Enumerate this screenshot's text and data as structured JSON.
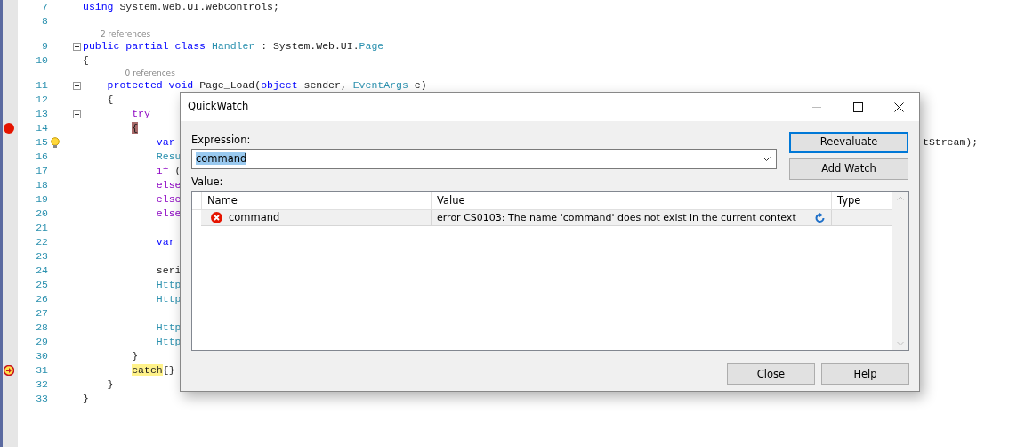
{
  "editor": {
    "lines": [
      {
        "number": "7",
        "tokens": [
          {
            "text": "using",
            "kind": "keyword"
          },
          {
            "text": " System.Web.UI.WebControls;",
            "kind": "plain"
          }
        ]
      },
      {
        "number": "8"
      },
      {
        "number": "9",
        "lens": "2 references",
        "fold": true,
        "tokens": [
          {
            "text": "public partial class",
            "kind": "keyword"
          },
          {
            "text": " Handler",
            "kind": "type"
          },
          {
            "text": " : System.Web.UI.",
            "kind": "plain"
          },
          {
            "text": "Page",
            "kind": "type"
          }
        ]
      },
      {
        "number": "10",
        "tokens": [
          {
            "text": "{",
            "kind": "plain"
          }
        ]
      },
      {
        "number": "11",
        "lens": "0 references",
        "fold": true,
        "tokens": [
          {
            "text": "    protected void",
            "kind": "keyword"
          },
          {
            "text": " Page_Load(",
            "kind": "plain"
          },
          {
            "text": "object",
            "kind": "keyword"
          },
          {
            "text": " sender, ",
            "kind": "plain"
          },
          {
            "text": "EventArgs",
            "kind": "type"
          },
          {
            "text": " e)",
            "kind": "plain"
          }
        ]
      },
      {
        "number": "12",
        "tokens": [
          {
            "text": "    {",
            "kind": "plain"
          }
        ]
      },
      {
        "number": "13",
        "fold": true,
        "tokens": [
          {
            "text": "        try",
            "kind": "control"
          }
        ]
      },
      {
        "number": "14",
        "glyph": {
          "kind": "breakpoint"
        },
        "tokens": [
          {
            "text": "        {",
            "kind": "plain",
            "highlighted": true
          }
        ]
      },
      {
        "number": "15",
        "glyph": {
          "kind": "lightbulb"
        },
        "tail": "tStream);",
        "tokens": [
          {
            "text": "            var",
            "kind": "keyword"
          }
        ]
      },
      {
        "number": "16",
        "tokens": [
          {
            "text": "            Resu",
            "kind": "type"
          }
        ]
      },
      {
        "number": "17",
        "tokens": [
          {
            "text": "            if",
            "kind": "control"
          },
          {
            "text": " (",
            "kind": "plain"
          }
        ]
      },
      {
        "number": "18",
        "tokens": [
          {
            "text": "            else",
            "kind": "control"
          }
        ]
      },
      {
        "number": "19",
        "tokens": [
          {
            "text": "            else",
            "kind": "control"
          }
        ]
      },
      {
        "number": "20",
        "tokens": [
          {
            "text": "            else",
            "kind": "control"
          }
        ]
      },
      {
        "number": "21"
      },
      {
        "number": "22",
        "tokens": [
          {
            "text": "            var",
            "kind": "keyword"
          }
        ]
      },
      {
        "number": "23"
      },
      {
        "number": "24",
        "tokens": [
          {
            "text": "            seri",
            "kind": "plain"
          }
        ]
      },
      {
        "number": "25",
        "tokens": [
          {
            "text": "            Http",
            "kind": "type"
          }
        ]
      },
      {
        "number": "26",
        "tokens": [
          {
            "text": "            Http",
            "kind": "type"
          }
        ]
      },
      {
        "number": "27"
      },
      {
        "number": "28",
        "tokens": [
          {
            "text": "            Http",
            "kind": "type"
          }
        ]
      },
      {
        "number": "29",
        "tokens": [
          {
            "text": "            Http",
            "kind": "type"
          }
        ]
      },
      {
        "number": "30",
        "tokens": [
          {
            "text": "        }",
            "kind": "plain"
          }
        ]
      },
      {
        "number": "31",
        "glyph": {
          "kind": "current"
        },
        "tokens": [
          {
            "text": "        catch",
            "kind": "plain",
            "highlighted": true
          },
          {
            "text": "{}",
            "kind": "plain"
          }
        ]
      },
      {
        "number": "32",
        "tokens": [
          {
            "text": "    }",
            "kind": "plain"
          }
        ]
      },
      {
        "number": "33",
        "tokens": [
          {
            "text": "}",
            "kind": "plain"
          }
        ]
      }
    ]
  },
  "dialog": {
    "title": "QuickWatch",
    "expression_label": "Expression:",
    "expression": {
      "value": "command",
      "selected": true
    },
    "value_label": "Value:",
    "buttons": [
      {
        "label": "Reevaluate",
        "focused": true
      },
      {
        "label": "Add Watch",
        "focused": false
      }
    ],
    "grid": {
      "columns": [
        "Name",
        "Value",
        "Type"
      ],
      "rows": [
        {
          "name": "command",
          "value": "error CS0103: The name 'command' does not exist in the current context",
          "kind": "error"
        }
      ]
    },
    "footer_buttons": [
      "Close",
      "Help"
    ]
  }
}
